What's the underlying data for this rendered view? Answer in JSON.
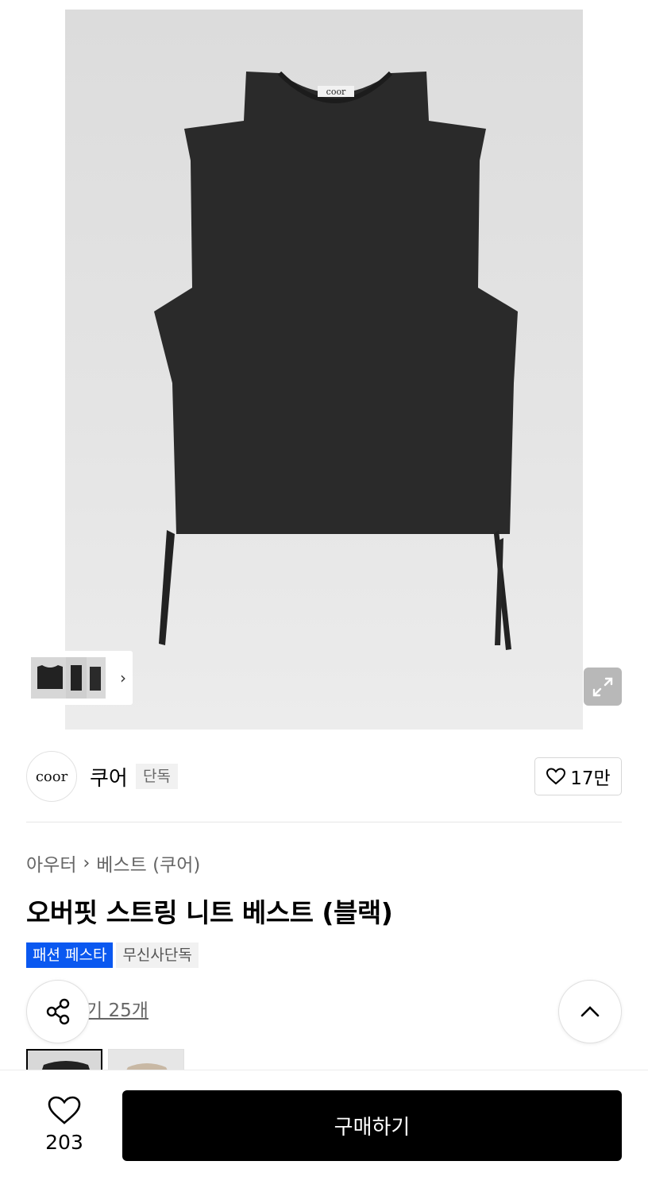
{
  "product_image": {
    "garment_label": "coor",
    "thumbnail_next": "›",
    "expand_icon": "expand-icon"
  },
  "brand": {
    "logo_text": "coor",
    "name": "쿠어",
    "badge": "단독",
    "likes": "17만"
  },
  "breadcrumb": {
    "category": "아우터",
    "separator": "›",
    "subcategory": "베스트 (쿠어)"
  },
  "product": {
    "title": "오버핏 스트링 니트 베스트 (블랙)",
    "tags": [
      "패션 페스타",
      "무신사단독"
    ],
    "reviews": "후기 25개",
    "reviews_visible": "기 25개"
  },
  "bottom_bar": {
    "wish_count": "203",
    "buy_label": "구매하기"
  },
  "colors": {
    "accent_blue": "#0a58f0",
    "buy_button": "#000000"
  }
}
